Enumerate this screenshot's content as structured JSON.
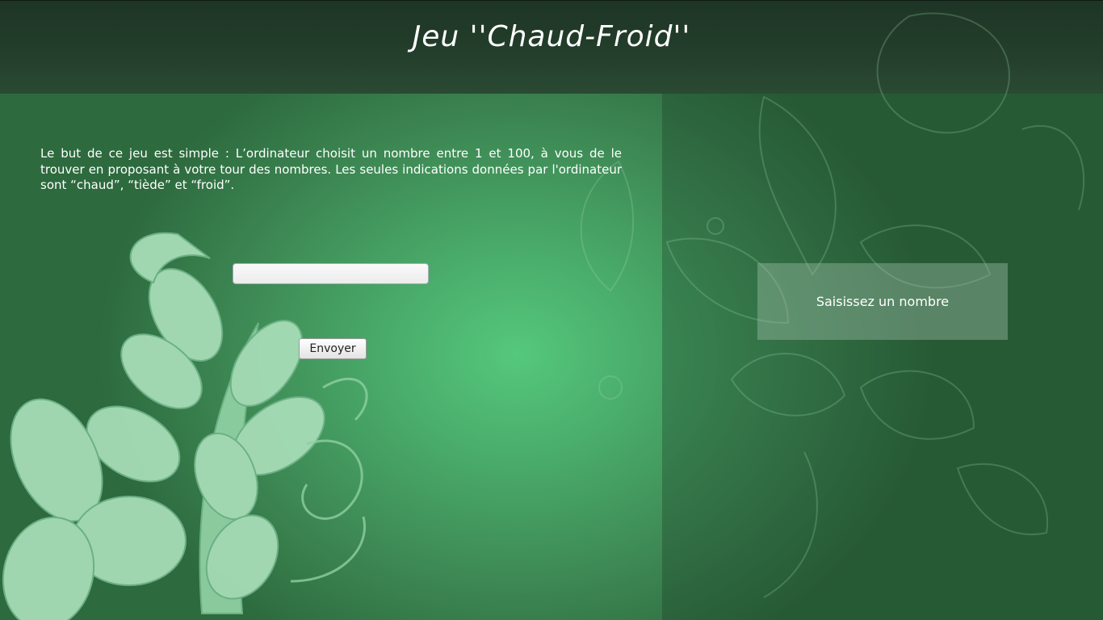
{
  "header": {
    "title": "Jeu ''Chaud-Froid''"
  },
  "game": {
    "intro": "Le but de ce jeu est simple : L’ordinateur choisit un nombre entre 1 et 100, à vous de le trouver en proposant à votre tour des nombres. Les seules indications données par l'ordinateur sont “chaud”, “tiède” et “froid”.",
    "input_value": "",
    "send_label": "Envoyer",
    "result_text": "Saisissez un nombre"
  },
  "colors": {
    "header_bg": "#243f2c",
    "page_bg": "#48a868",
    "leaf": "#a6dcb6",
    "result_box": "#8fb59b"
  }
}
